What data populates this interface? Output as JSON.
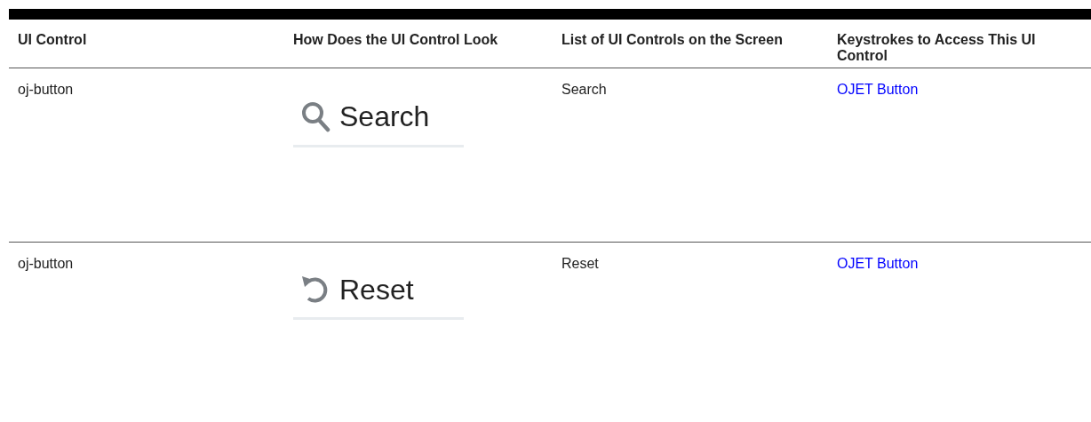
{
  "table": {
    "columns": [
      "UI Control",
      "How Does the UI Control Look",
      "List of UI Controls on the Screen",
      "Keystrokes to Access This UI Control"
    ],
    "rows": [
      {
        "control": "oj-button",
        "look": {
          "kind": "search",
          "label": "Search"
        },
        "screen_control": "Search",
        "keystrokes_link": "OJET Button"
      },
      {
        "control": "oj-button",
        "look": {
          "kind": "reset",
          "label": "Reset"
        },
        "screen_control": "Reset",
        "keystrokes_link": "OJET Button"
      }
    ]
  }
}
